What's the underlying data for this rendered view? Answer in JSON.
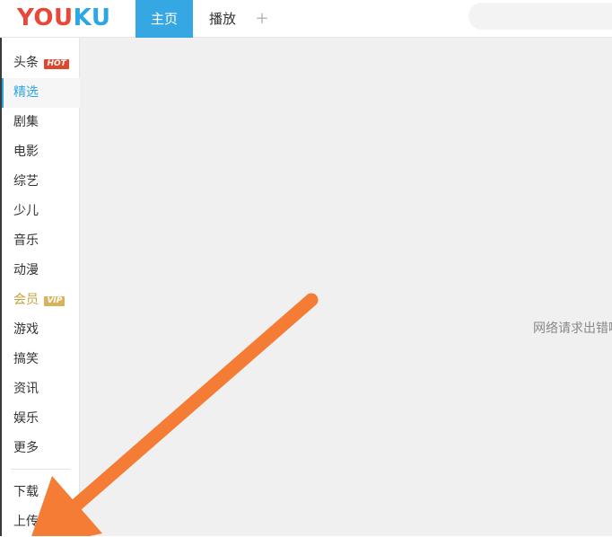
{
  "header": {
    "logo": {
      "part1": "YOU",
      "part2": "KU"
    },
    "tabs": [
      {
        "label": "主页",
        "active": true
      },
      {
        "label": "播放",
        "active": false
      }
    ],
    "add_tab_label": "+",
    "search": {
      "placeholder": ""
    }
  },
  "sidebar": {
    "items": [
      {
        "label": "头条",
        "badge": "HOT"
      },
      {
        "label": "精选",
        "active": true
      },
      {
        "label": "剧集"
      },
      {
        "label": "电影"
      },
      {
        "label": "综艺"
      },
      {
        "label": "少儿"
      },
      {
        "label": "音乐"
      },
      {
        "label": "动漫"
      },
      {
        "label": "会员",
        "badge": "VIP"
      },
      {
        "label": "游戏"
      },
      {
        "label": "搞笑"
      },
      {
        "label": "资讯"
      },
      {
        "label": "娱乐"
      },
      {
        "label": "更多"
      }
    ],
    "bottom_items": [
      {
        "label": "下载"
      },
      {
        "label": "上传"
      }
    ]
  },
  "main": {
    "error_message": "网络请求出错啦"
  },
  "colors": {
    "brand_red": "#e94738",
    "brand_blue": "#2ba7e8",
    "active_tab": "#35a8e3",
    "annotation_arrow": "#f47c34"
  }
}
